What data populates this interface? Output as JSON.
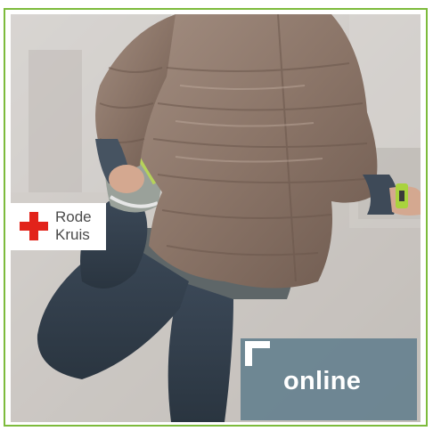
{
  "brand": {
    "line1": "Rode",
    "line2": "Kruis",
    "cross_color": "#e2231a"
  },
  "badge": {
    "label": "online",
    "color": "#5f7d8c"
  },
  "frame_color": "#7dbb3c",
  "photo": {
    "subject": "runner-stretching"
  }
}
